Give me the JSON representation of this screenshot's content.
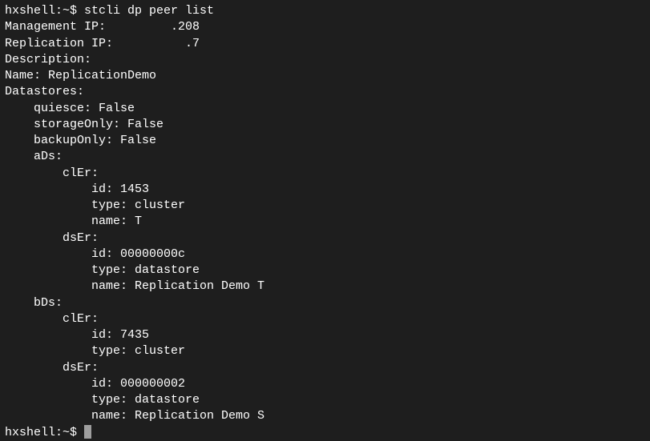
{
  "prompt1": "hxshell:~$ ",
  "command": "stcli dp peer list",
  "lines": {
    "mgmt_ip": "Management IP:         .208",
    "repl_ip": "Replication IP:          .7",
    "description": "Description:",
    "name": "Name: ReplicationDemo",
    "datastores": "Datastores:",
    "quiesce": "    quiesce: False",
    "storage_only": "    storageOnly: False",
    "backup_only": "    backupOnly: False",
    "ads": "    aDs:",
    "ads_cler": "        clEr:",
    "ads_cler_id": "            id: 1453",
    "ads_cler_type": "            type: cluster",
    "ads_cler_name": "            name: T",
    "ads_dser": "        dsEr:",
    "ads_dser_id": "            id: 00000000c",
    "ads_dser_type": "            type: datastore",
    "ads_dser_name": "            name: Replication Demo T",
    "bds": "    bDs:",
    "bds_cler": "        clEr:",
    "bds_cler_id": "            id: 7435",
    "bds_cler_type": "            type: cluster",
    "bds_dser": "        dsEr:",
    "bds_dser_id": "            id: 000000002",
    "bds_dser_type": "            type: datastore",
    "bds_dser_name": "            name: Replication Demo S"
  },
  "prompt2": "hxshell:~$ "
}
